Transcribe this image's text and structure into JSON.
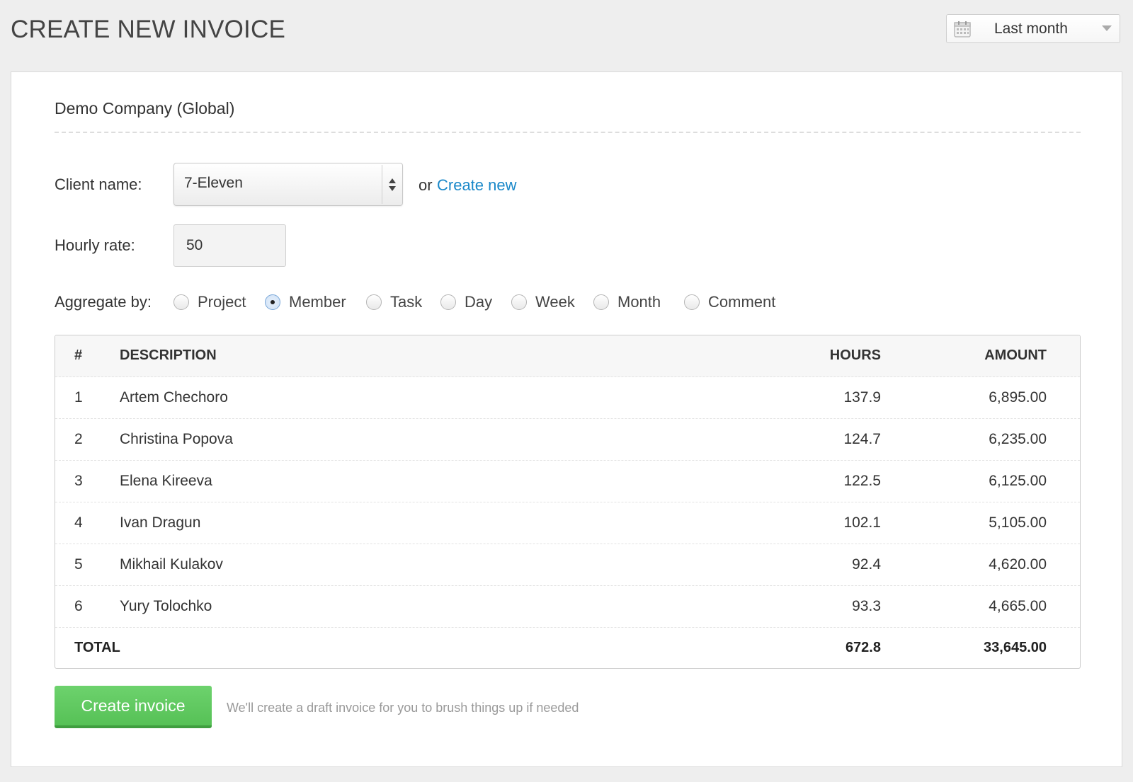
{
  "header": {
    "title": "CREATE NEW INVOICE",
    "date_range": {
      "icon": "calendar-icon",
      "label": "Last month"
    }
  },
  "card": {
    "company": "Demo Company (Global)",
    "client": {
      "label": "Client name:",
      "selected": "7-Eleven",
      "or_text": "or",
      "create_new_link": "Create new"
    },
    "rate": {
      "label": "Hourly rate:",
      "value": "50"
    },
    "aggregate": {
      "label": "Aggregate by:",
      "options": [
        {
          "label": "Project",
          "checked": false
        },
        {
          "label": "Member",
          "checked": true
        },
        {
          "label": "Task",
          "checked": false
        },
        {
          "label": "Day",
          "checked": false
        },
        {
          "label": "Week",
          "checked": false
        },
        {
          "label": "Month",
          "checked": false
        },
        {
          "label": "Comment",
          "checked": false
        }
      ]
    },
    "table": {
      "columns": {
        "num": "#",
        "desc": "DESCRIPTION",
        "hours": "HOURS",
        "amount": "AMOUNT"
      },
      "rows": [
        {
          "num": "1",
          "desc": "Artem Chechoro",
          "hours": "137.9",
          "amount": "6,895.00"
        },
        {
          "num": "2",
          "desc": "Christina Popova",
          "hours": "124.7",
          "amount": "6,235.00"
        },
        {
          "num": "3",
          "desc": "Elena Kireeva",
          "hours": "122.5",
          "amount": "6,125.00"
        },
        {
          "num": "4",
          "desc": "Ivan Dragun",
          "hours": "102.1",
          "amount": "5,105.00"
        },
        {
          "num": "5",
          "desc": "Mikhail Kulakov",
          "hours": "92.4",
          "amount": "4,620.00"
        },
        {
          "num": "6",
          "desc": "Yury Tolochko",
          "hours": "93.3",
          "amount": "4,665.00"
        }
      ],
      "total": {
        "label": "TOTAL",
        "hours": "672.8",
        "amount": "33,645.00"
      }
    },
    "actions": {
      "create_button": "Create invoice",
      "hint": "We'll create a draft invoice for you to brush things up if needed"
    }
  },
  "colors": {
    "accent_link": "#1a88c9",
    "create_button": "#5cc65c",
    "radio_selected": "#7aa7d8"
  }
}
